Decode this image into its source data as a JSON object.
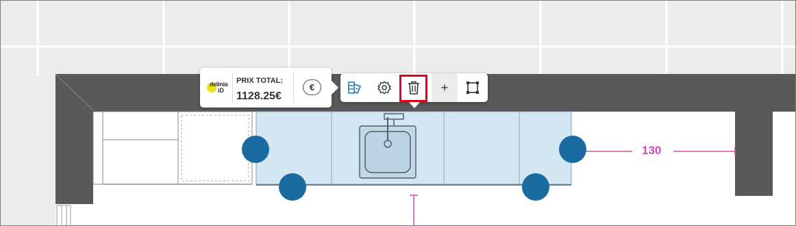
{
  "price_panel": {
    "brand_line1": "delinia",
    "brand_line2": "iD",
    "price_label": "PRIX TOTAL:",
    "price_value": "1128.25€",
    "currency_symbol": "€"
  },
  "toolbar": {
    "materials_icon": "materials-palette-icon",
    "settings_icon": "gear-icon",
    "delete_icon": "trash-icon",
    "add_label": "+",
    "resize_icon": "resize-frame-icon"
  },
  "plan": {
    "dimension_label": "130"
  },
  "colors": {
    "wall": "#595959",
    "cabinet_selected": "#d4e6f2",
    "handle": "#1a6ba0",
    "dimension": "#d54ab0",
    "highlight": "#e3001b"
  }
}
